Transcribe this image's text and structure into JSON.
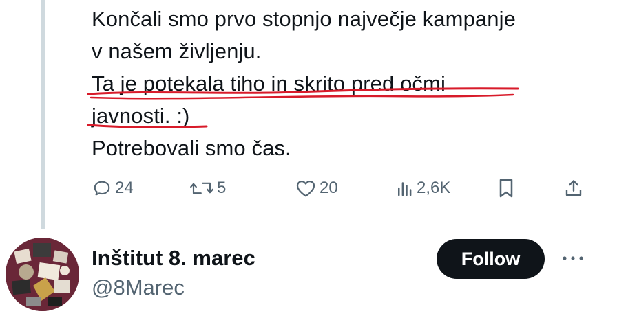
{
  "tweet": {
    "lines": [
      "Končali smo prvo stopnjo največje kampanje",
      "v našem življenju.",
      "Ta je potekala tiho in skrito pred očmi",
      "javnosti. :)",
      "Potrebovali smo čas."
    ]
  },
  "actions": {
    "replies": "24",
    "reposts": "5",
    "likes": "20",
    "views": "2,6K"
  },
  "profile": {
    "name": "Inštitut 8. marec",
    "handle": "@8Marec",
    "follow_label": "Follow"
  },
  "icons": {
    "reply": "reply-icon",
    "repost": "repost-icon",
    "like": "heart-icon",
    "views": "views-icon",
    "bookmark": "bookmark-icon",
    "share": "share-icon",
    "more": "more-icon"
  },
  "colors": {
    "text": "#0f1419",
    "secondary": "#536471",
    "underline": "#d81b2a",
    "thread_line": "#cfd9de",
    "follow_bg": "#0f1419"
  }
}
